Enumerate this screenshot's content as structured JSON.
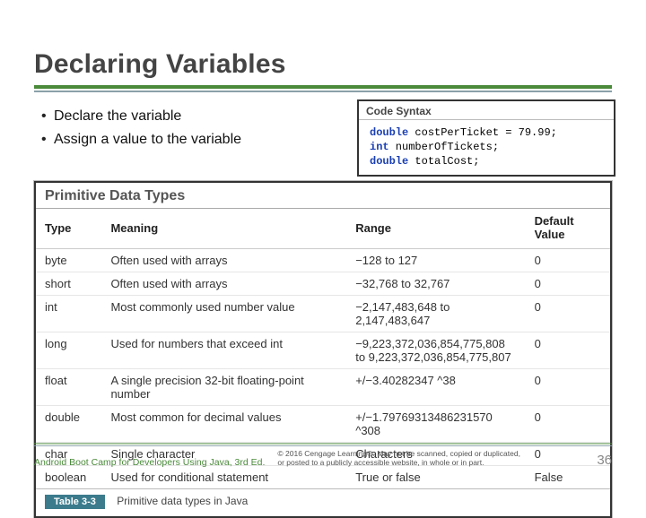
{
  "title": "Declaring Variables",
  "bullets": [
    "Declare the variable",
    "Assign a value to the variable"
  ],
  "code": {
    "heading": "Code Syntax",
    "lines": [
      {
        "kw": "double",
        "rest": " costPerTicket = 79.99;"
      },
      {
        "kw": "int",
        "rest": " numberOfTickets;"
      },
      {
        "kw": "double",
        "rest": " totalCost;"
      }
    ]
  },
  "table": {
    "title": "Primitive Data Types",
    "headers": [
      "Type",
      "Meaning",
      "Range",
      "Default Value"
    ],
    "rows": [
      [
        "byte",
        "Often used with arrays",
        "−128 to 127",
        "0"
      ],
      [
        "short",
        "Often used with arrays",
        "−32,768 to 32,767",
        "0"
      ],
      [
        "int",
        "Most commonly used number value",
        "−2,147,483,648 to 2,147,483,647",
        "0"
      ],
      [
        "long",
        "Used for numbers that exceed int",
        "−9,223,372,036,854,775,808 to 9,223,372,036,854,775,807",
        "0"
      ],
      [
        "float",
        "A single precision 32-bit floating-point number",
        "+/−3.40282347 ^38",
        "0"
      ],
      [
        "double",
        "Most common for decimal values",
        "+/−1.79769313486231570 ^308",
        "0"
      ],
      [
        "char",
        "Single character",
        "Characters",
        "0"
      ],
      [
        "boolean",
        "Used for conditional statement",
        "True or false",
        "False"
      ]
    ],
    "footer_tag": "Table 3-3",
    "footer_text": "Primitive data types in Java"
  },
  "footer": {
    "book": "Android Boot Camp for Developers Using Java, 3rd Ed.",
    "copy_line1": "© 2016 Cengage Learning®. May not be scanned, copied or duplicated,",
    "copy_line2": "or posted to a publicly accessible website, in whole or in part.",
    "page": "36"
  },
  "chart_data": {
    "type": "table",
    "title": "Primitive Data Types",
    "columns": [
      "Type",
      "Meaning",
      "Range",
      "Default Value"
    ],
    "rows": [
      [
        "byte",
        "Often used with arrays",
        "−128 to 127",
        "0"
      ],
      [
        "short",
        "Often used with arrays",
        "−32,768 to 32,767",
        "0"
      ],
      [
        "int",
        "Most commonly used number value",
        "−2,147,483,648 to 2,147,483,647",
        "0"
      ],
      [
        "long",
        "Used for numbers that exceed int",
        "−9,223,372,036,854,775,808 to 9,223,372,036,854,775,807",
        "0"
      ],
      [
        "float",
        "A single precision 32-bit floating-point number",
        "+/−3.40282347 ^38",
        "0"
      ],
      [
        "double",
        "Most common for decimal values",
        "+/−1.79769313486231570 ^308",
        "0"
      ],
      [
        "char",
        "Single character",
        "Characters",
        "0"
      ],
      [
        "boolean",
        "Used for conditional statement",
        "True or false",
        "False"
      ]
    ]
  }
}
